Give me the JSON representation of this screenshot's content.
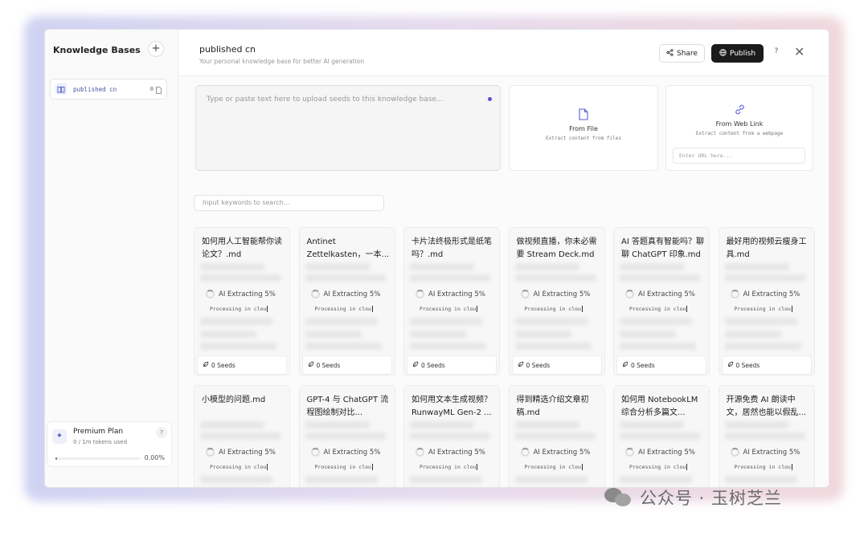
{
  "sidebar": {
    "title": "Knowledge Bases",
    "add_label": "+",
    "items": [
      {
        "name": "published cn",
        "count": "0"
      }
    ],
    "plan": {
      "name": "Premium Plan",
      "tokens": "0 / 1m tokens used",
      "help": "?",
      "percent": "0.00%",
      "progress": 0.0
    }
  },
  "header": {
    "title": "published cn",
    "subtitle": "Your personal knowledge base for better AI generation",
    "share_label": "Share",
    "publish_label": "Publish",
    "help_label": "?",
    "close_label": "✕"
  },
  "upload": {
    "placeholder": "Type or paste text here to upload seeds to this knowledge base..."
  },
  "sources": {
    "file": {
      "title": "From File",
      "desc": "Extract content from files"
    },
    "web": {
      "title": "From Web Link",
      "desc": "Extract content from a webpage",
      "url_placeholder": "Enter URL here..."
    }
  },
  "search": {
    "placeholder": "Input keywords to search..."
  },
  "cards": [
    {
      "title": "如何用人工智能帮你读论文？.md",
      "status": "AI Extracting 5%",
      "processing": "Processing in clou",
      "seeds": "0 Seeds"
    },
    {
      "title": "Antinet Zettelkasten，一本...",
      "status": "AI Extracting 5%",
      "processing": "Processing in clou",
      "seeds": "0 Seeds"
    },
    {
      "title": "卡片法终极形式是纸笔吗？.md",
      "status": "AI Extracting 5%",
      "processing": "Processing in clou",
      "seeds": "0 Seeds"
    },
    {
      "title": "做视频直播，你未必需要 Stream Deck.md",
      "status": "AI Extracting 5%",
      "processing": "Processing in clou",
      "seeds": "0 Seeds"
    },
    {
      "title": "AI 答题真有智能吗？聊聊 ChatGPT 印象.md",
      "status": "AI Extracting 5%",
      "processing": "Processing in clou",
      "seeds": "0 Seeds"
    },
    {
      "title": "最好用的视频云瘦身工具.md",
      "status": "AI Extracting 5%",
      "processing": "Processing in clou",
      "seeds": "0 Seeds"
    },
    {
      "title": "小模型的问题.md",
      "status": "AI Extracting 5%",
      "processing": "Processing in clou",
      "seeds": ""
    },
    {
      "title": "GPT-4 与 ChatGPT 流程图绘制对比...",
      "status": "AI Extracting 5%",
      "processing": "Processing in clou",
      "seeds": ""
    },
    {
      "title": "如何用文本生成视频？RunwayML Gen-2 ...",
      "status": "AI Extracting 5%",
      "processing": "Processing in clou",
      "seeds": ""
    },
    {
      "title": "得到精选介绍文章初稿.md",
      "status": "AI Extracting 5%",
      "processing": "Processing in clou",
      "seeds": ""
    },
    {
      "title": "如何用 NotebookLM 综合分析多篇文...",
      "status": "AI Extracting 5%",
      "processing": "Processing in clou",
      "seeds": ""
    },
    {
      "title": "开源免费 AI 朗读中文，居然也能以假乱...",
      "status": "AI Extracting 5%",
      "processing": "Processing in clou",
      "seeds": ""
    }
  ],
  "watermark": {
    "text": "公众号 · 玉树芝兰"
  }
}
